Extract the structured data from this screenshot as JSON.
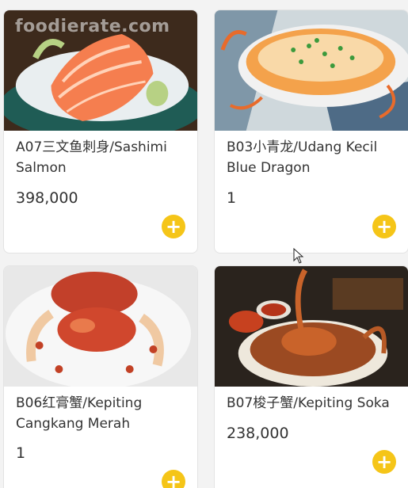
{
  "watermark": "foodierate.com",
  "items": [
    {
      "name": "A07三文鱼刺身/Sashimi Salmon",
      "price": "398,000",
      "add_icon": "plus-icon"
    },
    {
      "name": "B03小青龙/Udang Kecil Blue Dragon",
      "price": "1",
      "add_icon": "plus-icon"
    },
    {
      "name": "B06红膏蟹/Kepiting Cangkang Merah",
      "price": "1",
      "add_icon": "plus-icon"
    },
    {
      "name": "B07梭子蟹/Kepiting Soka",
      "price": "238,000",
      "add_icon": "plus-icon"
    }
  ],
  "colors": {
    "accent": "#f5c518",
    "background": "#f3f3f3",
    "card": "#ffffff"
  }
}
